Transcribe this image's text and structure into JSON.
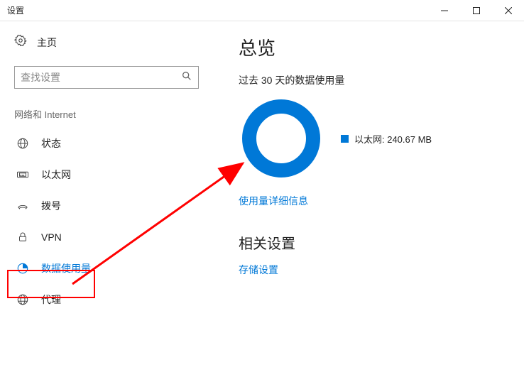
{
  "window": {
    "title": "设置"
  },
  "sidebar": {
    "home_label": "主页",
    "search_placeholder": "查找设置",
    "category": "网络和 Internet",
    "items": [
      {
        "label": "状态",
        "icon": "globe"
      },
      {
        "label": "以太网",
        "icon": "ethernet"
      },
      {
        "label": "拨号",
        "icon": "dialup"
      },
      {
        "label": "VPN",
        "icon": "vpn"
      },
      {
        "label": "数据使用量",
        "icon": "data-usage",
        "active": true
      },
      {
        "label": "代理",
        "icon": "proxy"
      }
    ]
  },
  "main": {
    "heading": "总览",
    "period_label": "过去 30 天的数据使用量",
    "legend_label": "以太网: 240.67 MB",
    "usage_details_link": "使用量详细信息",
    "related_heading": "相关设置",
    "storage_link": "存储设置"
  },
  "chart_data": {
    "type": "pie",
    "title": "过去 30 天的数据使用量",
    "series": [
      {
        "name": "以太网",
        "value": 240.67,
        "unit": "MB",
        "color": "#0078d7"
      }
    ]
  }
}
